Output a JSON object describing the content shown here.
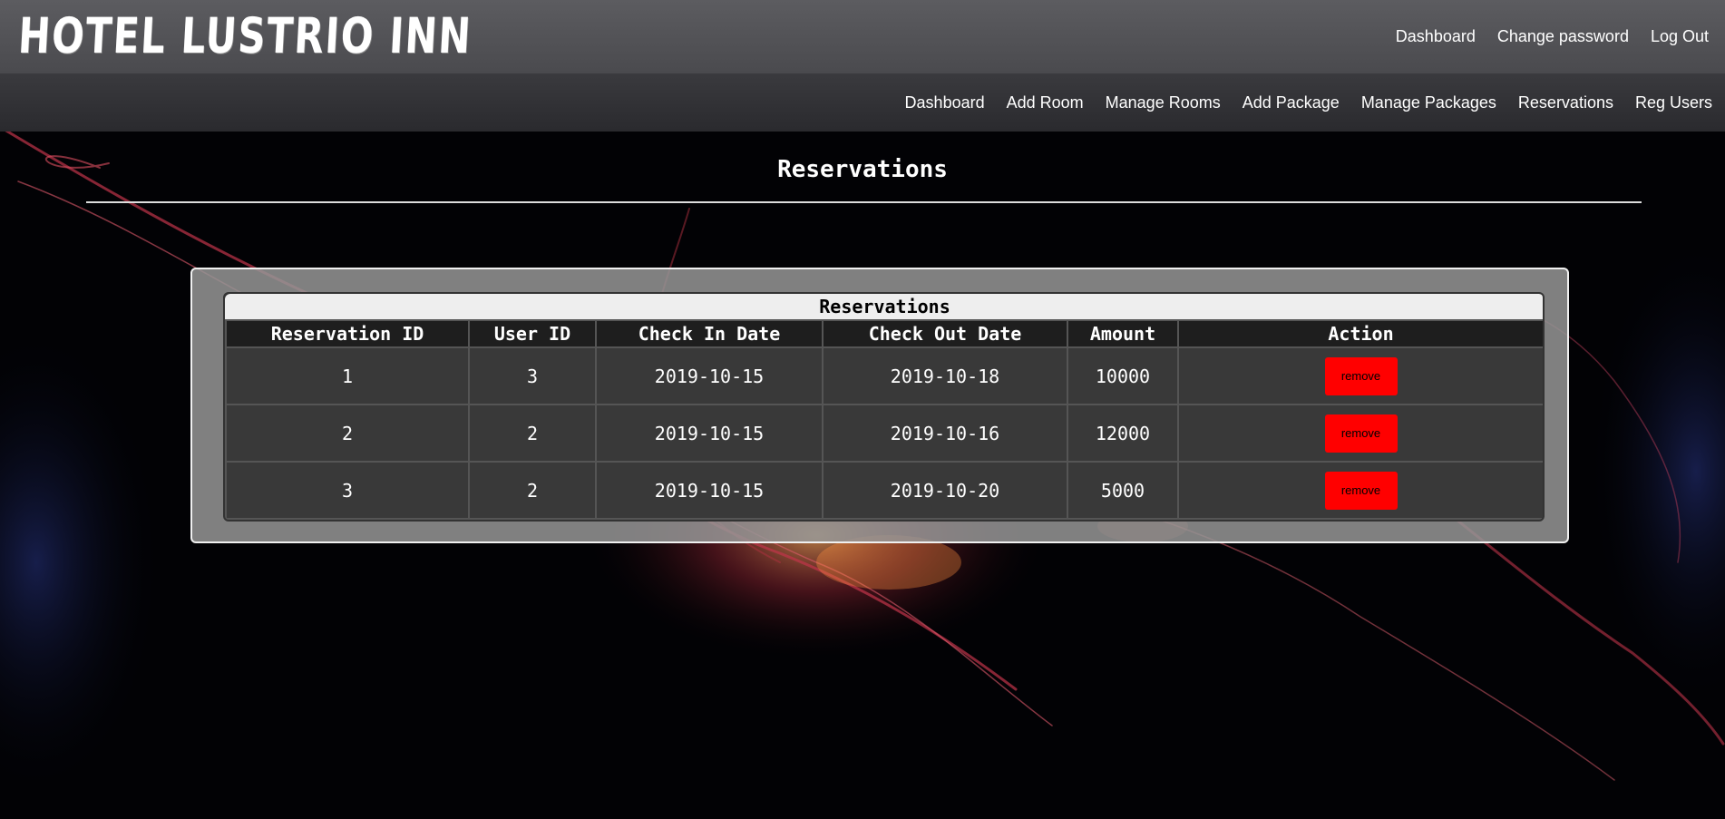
{
  "brand": "HOTEL LUSTRIO INN",
  "top_links": [
    "Dashboard",
    "Change password",
    "Log Out"
  ],
  "nav_links": [
    "Dashboard",
    "Add Room",
    "Manage Rooms",
    "Add Package",
    "Manage Packages",
    "Reservations",
    "Reg Users"
  ],
  "page_title": "Reservations",
  "table": {
    "caption": "Reservations",
    "headers": [
      "Reservation ID",
      "User ID",
      "Check In Date",
      "Check Out Date",
      "Amount",
      "Action"
    ],
    "rows": [
      {
        "id": "1",
        "user_id": "3",
        "check_in": "2019-10-15",
        "check_out": "2019-10-18",
        "amount": "10000",
        "action": "remove"
      },
      {
        "id": "2",
        "user_id": "2",
        "check_in": "2019-10-15",
        "check_out": "2019-10-16",
        "amount": "12000",
        "action": "remove"
      },
      {
        "id": "3",
        "user_id": "2",
        "check_in": "2019-10-15",
        "check_out": "2019-10-20",
        "amount": "5000",
        "action": "remove"
      }
    ]
  },
  "colors": {
    "remove_button": "#ff0000",
    "topbar": "#555558",
    "background": "#020205"
  }
}
